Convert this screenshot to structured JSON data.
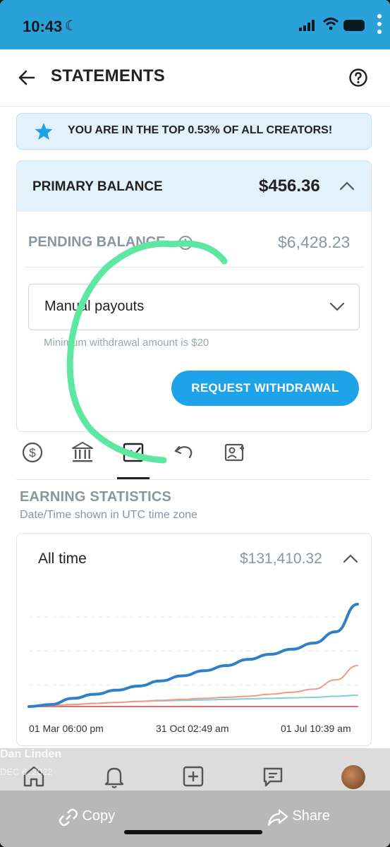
{
  "status_bar": {
    "time": "10:43"
  },
  "header": {
    "title": "STATEMENTS"
  },
  "banner": {
    "text": "YOU ARE IN THE TOP 0.53% OF ALL CREATORS!"
  },
  "balance": {
    "primary_label": "PRIMARY BALANCE",
    "primary_amount": "$456.36",
    "pending_label": "PENDING BALANCE",
    "pending_amount": "$6,428.23",
    "payout_select": "Manual payouts",
    "min_note": "Minimum withdrawal amount is $20",
    "withdraw_button": "REQUEST WITHDRAWAL"
  },
  "tabs": {
    "items": [
      "dollar-icon",
      "bank-icon",
      "statistics-icon",
      "refund-icon",
      "referral-icon"
    ],
    "active_index": 2
  },
  "earnings": {
    "title": "EARNING STATISTICS",
    "subtitle": "Date/Time shown in UTC time zone",
    "range_label": "All time",
    "total": "$131,410.32"
  },
  "chart_data": {
    "type": "line",
    "x_labels": [
      "01 Mar 06:00 pm",
      "31 Oct 02:49 am",
      "01 Jul 10:39 am"
    ],
    "grid": true,
    "series": [
      {
        "color": "#2f80c9",
        "values": [
          0,
          2,
          8,
          12,
          16,
          20,
          25,
          30,
          35,
          40,
          46,
          51,
          56,
          62,
          73,
          100
        ]
      },
      {
        "color": "#ef9c82",
        "values": [
          0,
          1,
          2,
          3,
          4,
          5,
          6,
          7,
          8,
          9,
          10,
          12,
          14,
          17,
          26,
          40
        ]
      },
      {
        "color": "#7fd0d8",
        "values": [
          0,
          1,
          2,
          3,
          4,
          5,
          5.5,
          6,
          6.5,
          7,
          7.5,
          8,
          8.5,
          9,
          10,
          11
        ]
      },
      {
        "color": "#e06a6a",
        "values": [
          0,
          0,
          0,
          0,
          0,
          0,
          0,
          0,
          0,
          0,
          0,
          0,
          0,
          0,
          0,
          0
        ]
      }
    ]
  },
  "bottom_nav": {
    "items": [
      "home-icon",
      "bell-icon",
      "add-post-icon",
      "messages-icon",
      "avatar"
    ]
  },
  "overlay": {
    "author": "Dan Linden",
    "date": "DEC 6, 2022"
  },
  "share_bar": {
    "copy_label": "Copy",
    "share_label": "Share"
  }
}
